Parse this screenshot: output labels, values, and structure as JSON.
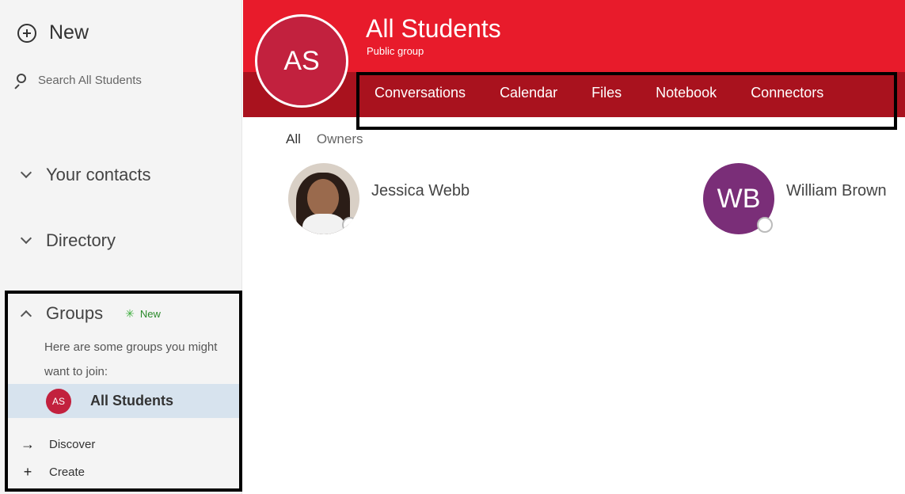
{
  "sidebar": {
    "new_label": "New",
    "search_placeholder": "Search All Students",
    "sections": {
      "contacts": "Your contacts",
      "directory": "Directory"
    },
    "groups": {
      "label": "Groups",
      "new_badge": "New",
      "hint": "Here are some groups you might want to join:",
      "item": {
        "initials": "AS",
        "name": "All Students"
      },
      "discover_label": "Discover",
      "create_label": "Create"
    }
  },
  "header": {
    "initials": "AS",
    "title": "All Students",
    "subtitle": "Public group",
    "tabs": [
      "Conversations",
      "Calendar",
      "Files",
      "Notebook",
      "Connectors"
    ]
  },
  "members": {
    "filters": [
      "All",
      "Owners"
    ],
    "list": [
      {
        "name": "Jessica Webb"
      },
      {
        "name": "William Brown",
        "initials": "WB"
      }
    ]
  },
  "colors": {
    "header_red": "#e81b2b",
    "tab_band": "#a9121e",
    "group_avatar": "#c2213e",
    "member_purple": "#7a2e78",
    "selected_bg": "#d7e3ee"
  }
}
